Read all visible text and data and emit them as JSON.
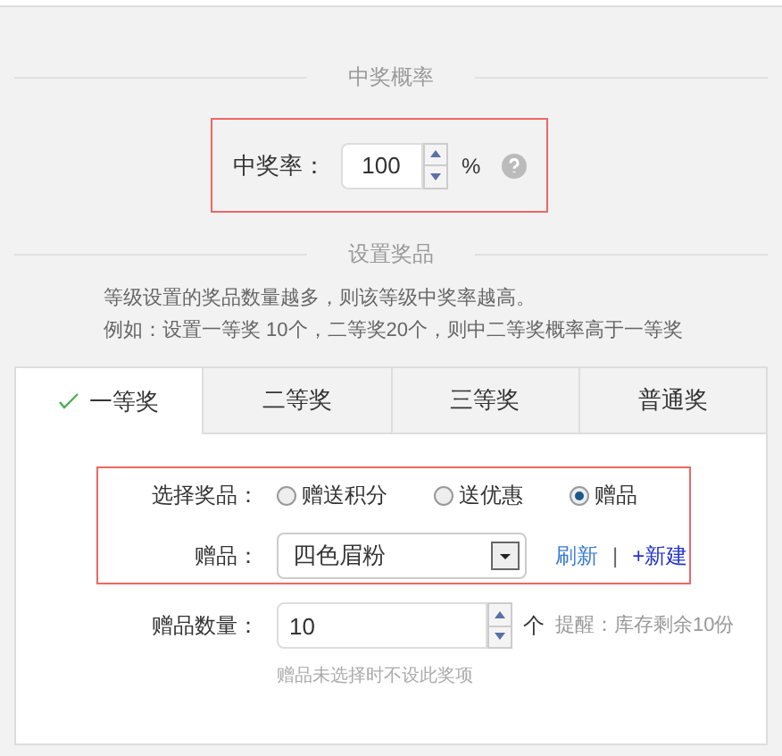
{
  "probability": {
    "section_title": "中奖概率",
    "label": "中奖率：",
    "value": "100",
    "unit": "%"
  },
  "prizes": {
    "section_title": "设置奖品",
    "notes": [
      "等级设置的奖品数量越多，则该等级中奖率越高。",
      "例如：设置一等奖 10个，二等奖20个，则中二等奖概率高于一等奖"
    ],
    "tabs": [
      {
        "label": "一等奖",
        "selected": true,
        "checked": true
      },
      {
        "label": "二等奖",
        "selected": false,
        "checked": false
      },
      {
        "label": "三等奖",
        "selected": false,
        "checked": false
      },
      {
        "label": "普通奖",
        "selected": false,
        "checked": false
      }
    ],
    "form": {
      "type_label": "选择奖品：",
      "options": [
        {
          "label": "赠送积分",
          "selected": false
        },
        {
          "label": "送优惠",
          "selected": false
        },
        {
          "label": "赠品",
          "selected": true
        }
      ],
      "gift_label": "赠品：",
      "gift_value": "四色眉粉",
      "refresh": "刷新",
      "separator": "|",
      "new": "+新建",
      "quantity_label": "赠品数量：",
      "quantity": "10",
      "quantity_unit": "个",
      "reminder": "提醒：库存剩余10份",
      "hint": "赠品未选择时不设此奖项"
    }
  }
}
